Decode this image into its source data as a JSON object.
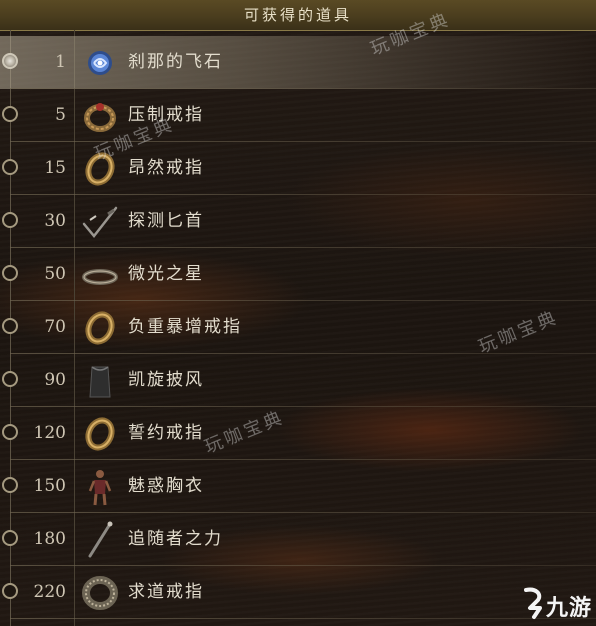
{
  "header": {
    "title": "可获得的道具"
  },
  "rows": [
    {
      "cost": "1",
      "name": "刹那的飞石",
      "icon": "blue-stone-icon",
      "selected": true
    },
    {
      "cost": "5",
      "name": "压制戒指",
      "icon": "ornate-ring-icon",
      "selected": false
    },
    {
      "cost": "15",
      "name": "昂然戒指",
      "icon": "gold-ring-icon",
      "selected": false
    },
    {
      "cost": "30",
      "name": "探测匕首",
      "icon": "dagger-icon",
      "selected": false
    },
    {
      "cost": "50",
      "name": "微光之星",
      "icon": "circlet-icon",
      "selected": false
    },
    {
      "cost": "70",
      "name": "负重暴增戒指",
      "icon": "gold-ring-icon",
      "selected": false
    },
    {
      "cost": "90",
      "name": "凯旋披风",
      "icon": "cloak-icon",
      "selected": false
    },
    {
      "cost": "120",
      "name": "誓约戒指",
      "icon": "gold-ring-icon",
      "selected": false
    },
    {
      "cost": "150",
      "name": "魅惑胸衣",
      "icon": "corset-icon",
      "selected": false
    },
    {
      "cost": "180",
      "name": "追随者之力",
      "icon": "staff-icon",
      "selected": false
    },
    {
      "cost": "220",
      "name": "求道戒指",
      "icon": "engraved-ring-icon",
      "selected": false
    }
  ],
  "watermarks": [
    "玩咖宝典",
    "玩咖宝典",
    "玩咖宝典",
    "玩咖宝典"
  ],
  "logo": {
    "text": "九游",
    "icon": "jiuyou-logo-icon"
  },
  "colors": {
    "header_bg": "#4a3d1e",
    "selected_row": "#b4aa96",
    "text": "#e2dccd",
    "background": "#1c1510"
  }
}
